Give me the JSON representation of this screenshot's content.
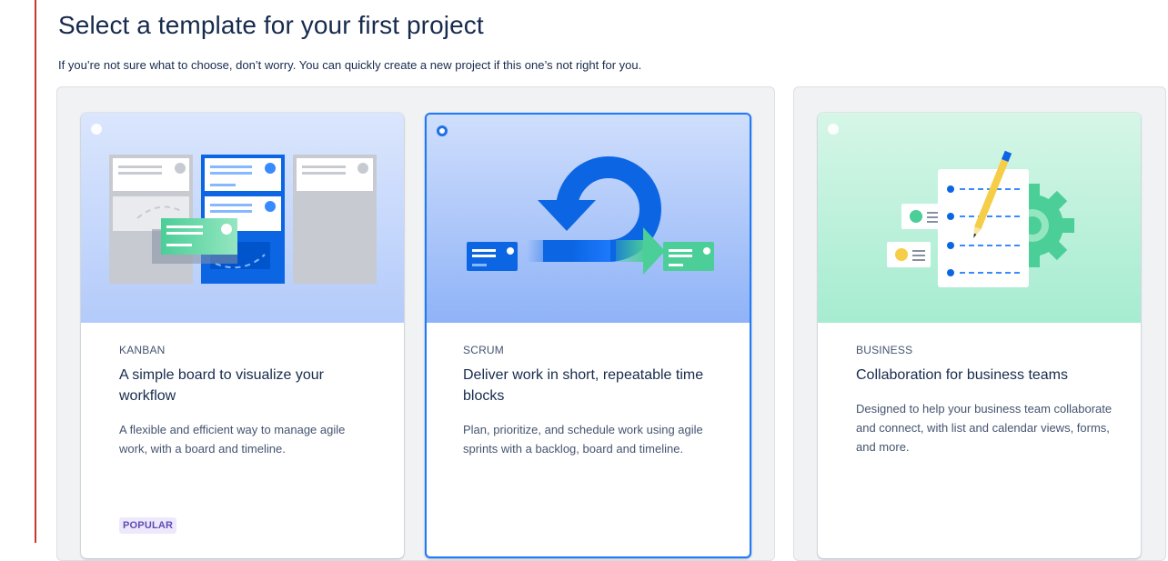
{
  "page": {
    "title": "Select a template for your first project",
    "subtitle": "If you’re not sure what to choose, don’t worry. You can quickly create a new project if this one’s not right for you."
  },
  "templates": [
    {
      "eyebrow": "KANBAN",
      "heading": "A simple board to visualize your workflow",
      "description": "A flexible and efficient way to manage agile work, with a board and timeline.",
      "badge": "POPULAR",
      "selected": false,
      "illustration_icon": "kanban-board-icon",
      "illustration_bg": "#c5d7fb"
    },
    {
      "eyebrow": "SCRUM",
      "heading": "Deliver work in short, repeatable time blocks",
      "description": "Plan, prioritize, and schedule work using agile sprints with a backlog, board and timeline.",
      "selected": true,
      "illustration_icon": "sprint-cycle-icon",
      "illustration_bg": "#a9c4fa"
    },
    {
      "eyebrow": "BUSINESS",
      "heading": "Collaboration for business teams",
      "description": "Designed to help your business team collaborate and connect, with list and calendar views, forms, and more.",
      "selected": false,
      "illustration_icon": "checklist-pencil-icon",
      "illustration_bg": "#baf0da"
    }
  ],
  "colors": {
    "accent": "#0c66e4",
    "selected_border": "#1d7afc",
    "badge_bg": "#eee8fc",
    "badge_text": "#5e4db2",
    "left_rule": "#c9372c"
  }
}
